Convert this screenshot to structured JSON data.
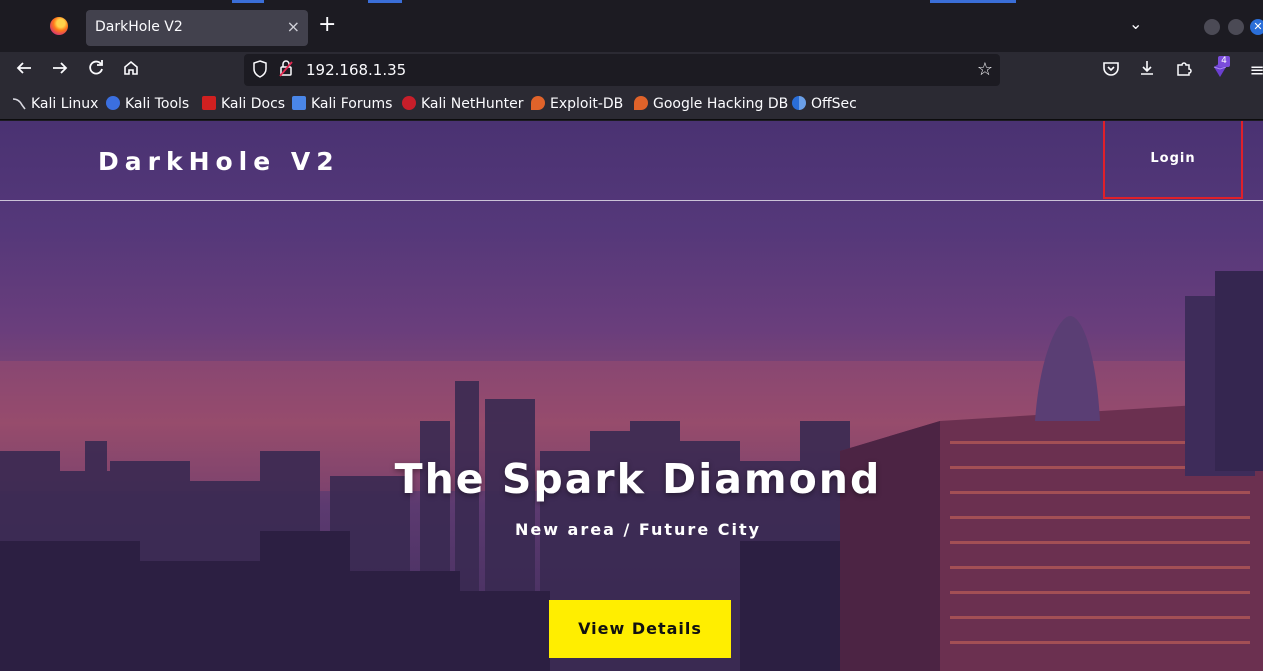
{
  "browser": {
    "tab": {
      "title": "DarkHole V2",
      "close": "×"
    },
    "new_tab": "+",
    "list_tabs": "⌄",
    "url": "192.168.1.35",
    "extensions_badge": "4",
    "bookmarks": [
      {
        "label": "Kali Linux",
        "icon": "kali-icon"
      },
      {
        "label": "Kali Tools",
        "icon": "kali-tools-icon"
      },
      {
        "label": "Kali Docs",
        "icon": "kali-docs-icon"
      },
      {
        "label": "Kali Forums",
        "icon": "kali-forums-icon"
      },
      {
        "label": "Kali NetHunter",
        "icon": "nethunter-icon"
      },
      {
        "label": "Exploit-DB",
        "icon": "exploit-db-icon"
      },
      {
        "label": "Google Hacking DB",
        "icon": "ghdb-icon"
      },
      {
        "label": "OffSec",
        "icon": "offsec-icon"
      }
    ]
  },
  "site": {
    "brand": "DarkHole V2",
    "nav_login": "Login",
    "hero_title": "The Spark Diamond",
    "hero_subtitle": "New area / Future City",
    "cta_label": "View Details"
  },
  "colors": {
    "accent": "#ffee00",
    "highlight_border": "#e0202a",
    "browser_chrome": "#2b2a33"
  }
}
